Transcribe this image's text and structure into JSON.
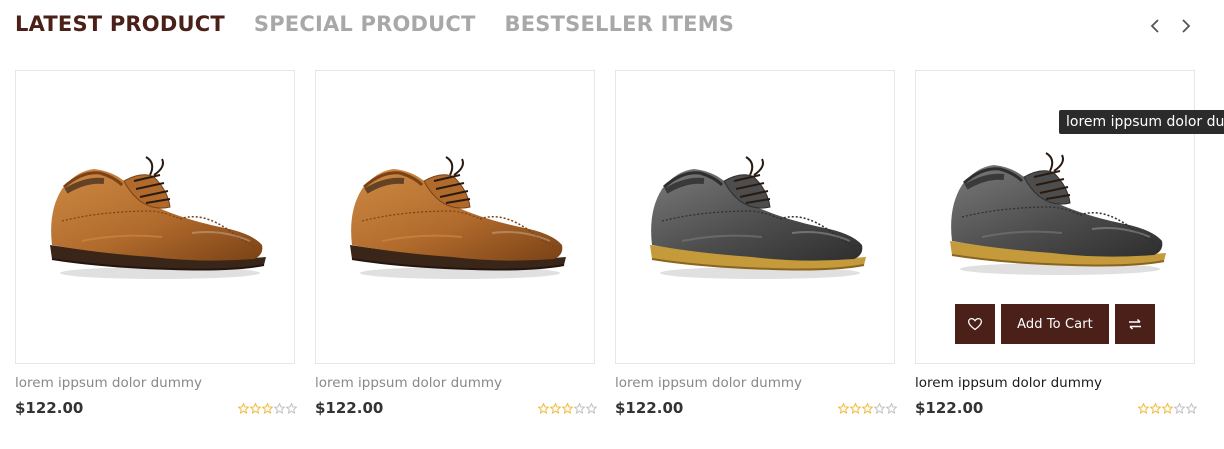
{
  "tabs": [
    {
      "label": "LATEST PRODUCT",
      "active": true
    },
    {
      "label": "SPECIAL PRODUCT",
      "active": false
    },
    {
      "label": "BESTSELLER ITEMS",
      "active": false
    }
  ],
  "nav": {
    "prev_icon": "chevron-left-icon",
    "next_icon": "chevron-right-icon"
  },
  "products": [
    {
      "title": "lorem ippsum dolor dummy",
      "price": "$122.00",
      "rating": 3,
      "max_rating": 5,
      "shoe_color": "brown"
    },
    {
      "title": "lorem ippsum dolor dummy",
      "price": "$122.00",
      "rating": 3,
      "max_rating": 5,
      "shoe_color": "brown"
    },
    {
      "title": "lorem ippsum dolor dummy",
      "price": "$122.00",
      "rating": 3,
      "max_rating": 5,
      "shoe_color": "grey"
    },
    {
      "title": "lorem ippsum dolor dummy",
      "price": "$122.00",
      "rating": 3,
      "max_rating": 5,
      "shoe_color": "grey"
    }
  ],
  "hover_actions": {
    "wishlist_icon": "heart-icon",
    "add_to_cart_label": "Add To Cart",
    "compare_icon": "compare-arrows-icon"
  },
  "tooltip": {
    "text": "lorem ippsum dolor dummy"
  },
  "colors": {
    "accent": "#4a2019",
    "tab_inactive": "#a8a8a8",
    "star_filled": "#f0b429",
    "star_empty": "#bbbbbb"
  }
}
